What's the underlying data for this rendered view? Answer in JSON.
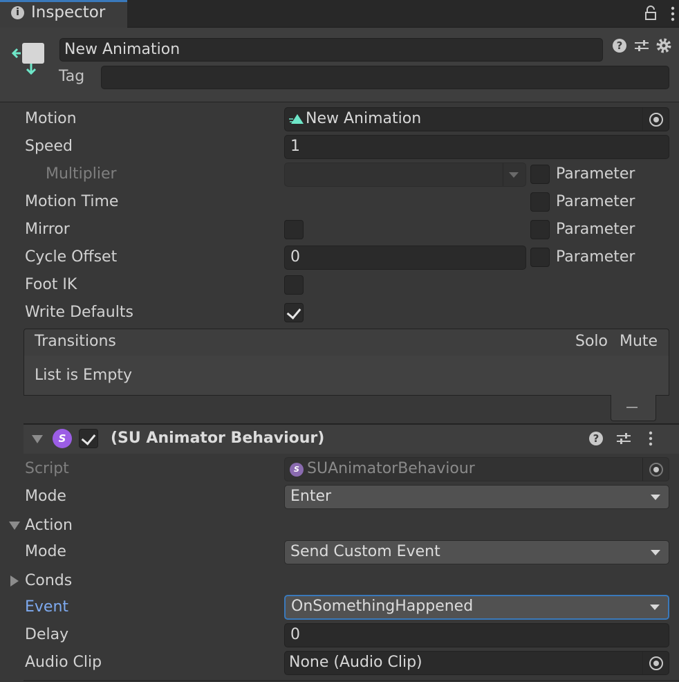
{
  "tab": {
    "label": "Inspector",
    "icon": "info-icon"
  },
  "header": {
    "name_value": "New Animation",
    "tag_label": "Tag",
    "tag_value": ""
  },
  "state": {
    "motion": {
      "label": "Motion",
      "value": "New Animation"
    },
    "speed": {
      "label": "Speed",
      "value": "1"
    },
    "multiplier": {
      "label": "Multiplier",
      "value": ""
    },
    "motion_time": {
      "label": "Motion Time"
    },
    "mirror": {
      "label": "Mirror",
      "checked": false
    },
    "cycle_offset": {
      "label": "Cycle Offset",
      "value": "0"
    },
    "foot_ik": {
      "label": "Foot IK",
      "checked": false
    },
    "write_defaults": {
      "label": "Write Defaults",
      "checked": true
    },
    "parameter_label": "Parameter"
  },
  "transitions": {
    "title": "Transitions",
    "solo": "Solo",
    "mute": "Mute",
    "empty_text": "List is Empty"
  },
  "component": {
    "title": "(SU Animator Behaviour)",
    "enabled": true,
    "icon_letter": "S",
    "script": {
      "label": "Script",
      "value": "SUAnimatorBehaviour"
    },
    "mode": {
      "label": "Mode",
      "value": "Enter"
    },
    "action": {
      "label": "Action",
      "mode": {
        "label": "Mode",
        "value": "Send Custom Event"
      },
      "conds": {
        "label": "Conds"
      },
      "event": {
        "label": "Event",
        "value": "OnSomethingHappened"
      },
      "delay": {
        "label": "Delay",
        "value": "0"
      },
      "audio_clip": {
        "label": "Audio Clip",
        "value": "None (Audio Clip)"
      }
    }
  },
  "colors": {
    "accent": "#3a79bb",
    "highlight_label": "#7eaaf0",
    "su_purple": "#9b5de5",
    "motion_icon": "#6ee6c8"
  }
}
